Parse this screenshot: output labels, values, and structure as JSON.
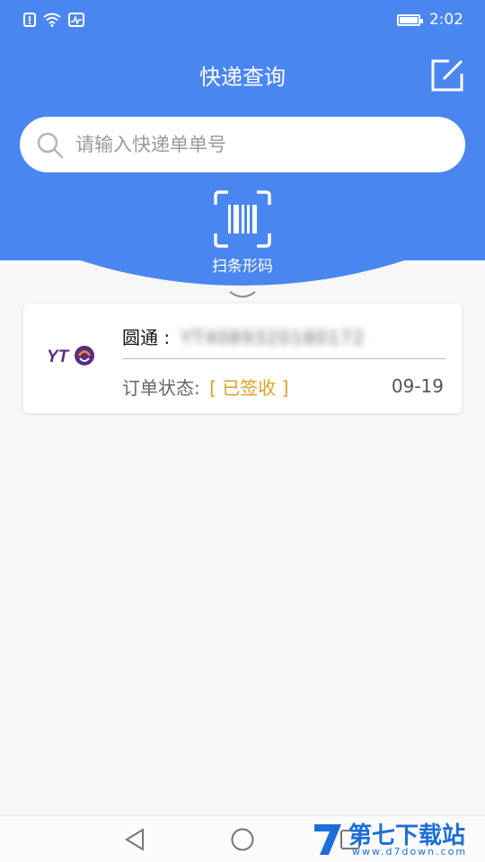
{
  "status_bar": {
    "time": "2:02"
  },
  "header": {
    "title": "快递查询"
  },
  "search": {
    "placeholder": "请输入快递单单号"
  },
  "scan": {
    "label": "扫条形码"
  },
  "packages": [
    {
      "carrier": "圆通",
      "separator": ":",
      "tracking_number": "YT4089320180172",
      "status_label": "订单状态:",
      "status": "[ 已签收 ]",
      "date": "09-19",
      "logo_text": "YTO"
    }
  ],
  "watermark": {
    "brand": "第七下载站",
    "url": "www.d7down.com"
  },
  "colors": {
    "primary": "#4a86f0",
    "status_signed": "#e0a126",
    "logo_purple": "#5a2d82",
    "logo_orange": "#f08a24"
  }
}
